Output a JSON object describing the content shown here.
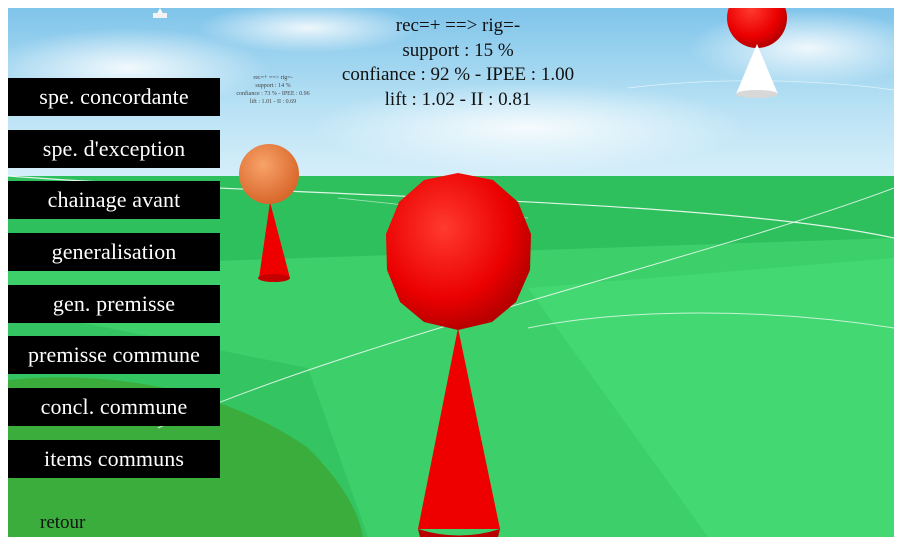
{
  "rule": {
    "line1": "rec=+ ==> rig=-",
    "line2": "support : 15 %",
    "line3": "confiance : 92 %  -  IPEE : 1.00",
    "line4": "lift : 1.02 -  II : 0.81"
  },
  "tiny_rule": {
    "line1": "rec=+ ==> rig=-",
    "line2": "support : 14 %",
    "line3": "confiance : 73 %  -  IPEE : 0.96",
    "line4": "lift : 1.01 -  II : 0.69"
  },
  "menu": {
    "items": [
      {
        "label": "spe. concordante"
      },
      {
        "label": "spe. d'exception"
      },
      {
        "label": "chainage avant"
      },
      {
        "label": "generalisation"
      },
      {
        "label": "gen. premisse"
      },
      {
        "label": "premisse commune"
      },
      {
        "label": "concl. commune"
      },
      {
        "label": "items communs"
      }
    ]
  },
  "back": {
    "label": "retour"
  },
  "colors": {
    "sky": "#9cd4ee",
    "ground": "#3ed26c",
    "sphere_red": "#ee0000",
    "sphere_orange": "#f0894a",
    "cone_white": "#ffffff",
    "button_bg": "#000000",
    "button_text": "#ffffff"
  }
}
